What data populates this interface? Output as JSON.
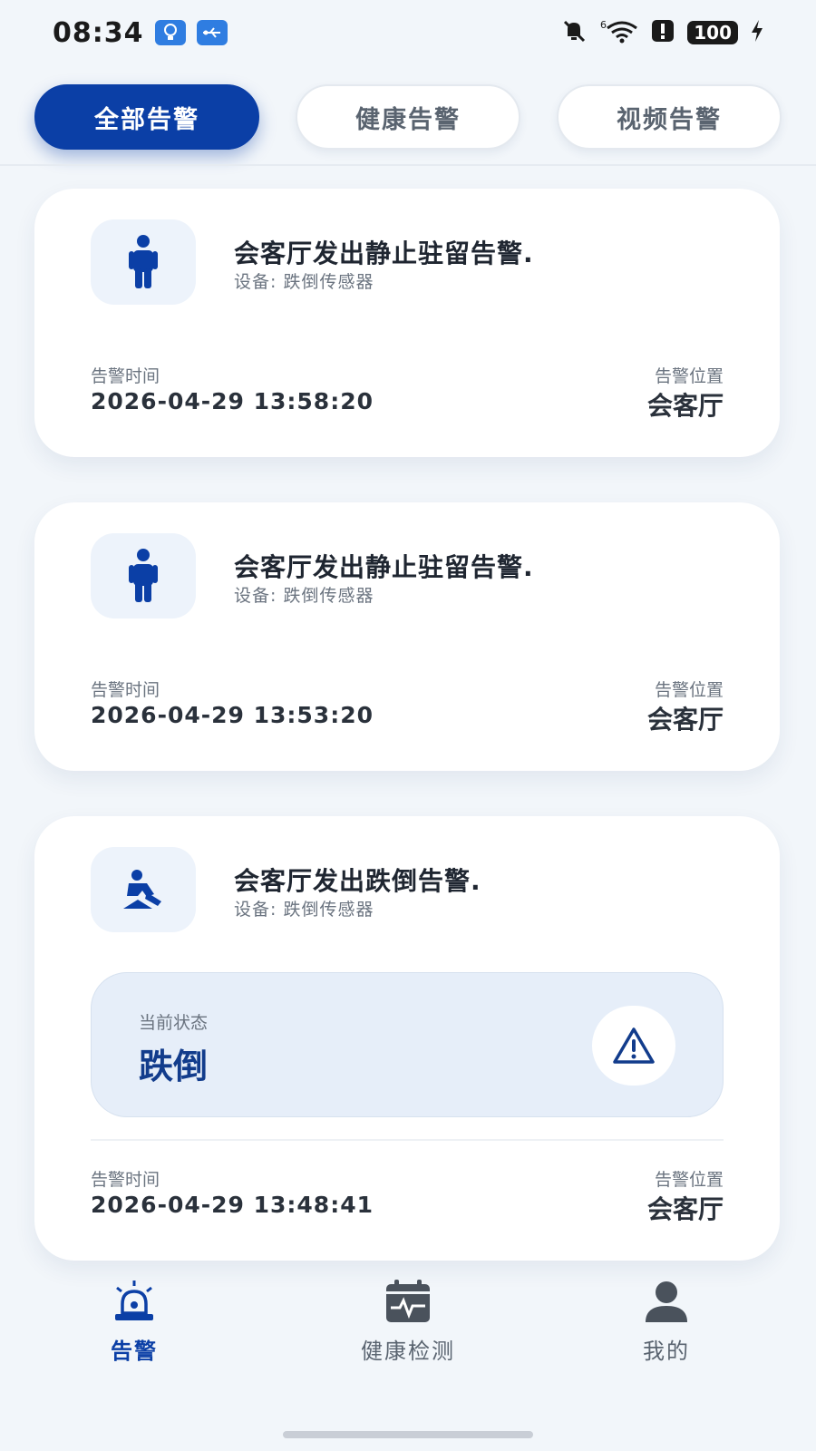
{
  "status_bar": {
    "time": "08:34",
    "battery": "100",
    "icons": [
      "bulb-icon",
      "usb-icon",
      "mute-icon",
      "wifi-icon",
      "alert-icon",
      "charging-icon"
    ]
  },
  "tabs": [
    {
      "label": "全部告警",
      "active": true
    },
    {
      "label": "健康告警",
      "active": false
    },
    {
      "label": "视频告警",
      "active": false
    }
  ],
  "alerts": [
    {
      "icon": "standing-person-icon",
      "title": "会客厅发出静止驻留告警.",
      "device": "设备:  跌倒传感器",
      "time_label": "告警时间",
      "time": "2026-04-29 13:58:20",
      "location_label": "告警位置",
      "location": "会客厅"
    },
    {
      "icon": "standing-person-icon",
      "title": "会客厅发出静止驻留告警.",
      "device": "设备:  跌倒传感器",
      "time_label": "告警时间",
      "time": "2026-04-29 13:53:20",
      "location_label": "告警位置",
      "location": "会客厅"
    },
    {
      "icon": "fall-person-icon",
      "title": "会客厅发出跌倒告警.",
      "device": "设备:  跌倒传感器",
      "state_label": "当前状态",
      "state": "跌倒",
      "state_icon": "warning-triangle-icon",
      "time_label": "告警时间",
      "time": "2026-04-29 13:48:41",
      "location_label": "告警位置",
      "location": "会客厅"
    }
  ],
  "bottom_nav": [
    {
      "label": "告警",
      "icon": "alarm-light-icon",
      "active": true
    },
    {
      "label": "健康检测",
      "icon": "health-calendar-icon",
      "active": false
    },
    {
      "label": "我的",
      "icon": "user-icon",
      "active": false
    }
  ],
  "colors": {
    "primary": "#0b3fa6",
    "background": "#f2f6fa",
    "card": "#ffffff",
    "icon_bg": "#edf3fb",
    "state_bg": "#e6eef9"
  }
}
